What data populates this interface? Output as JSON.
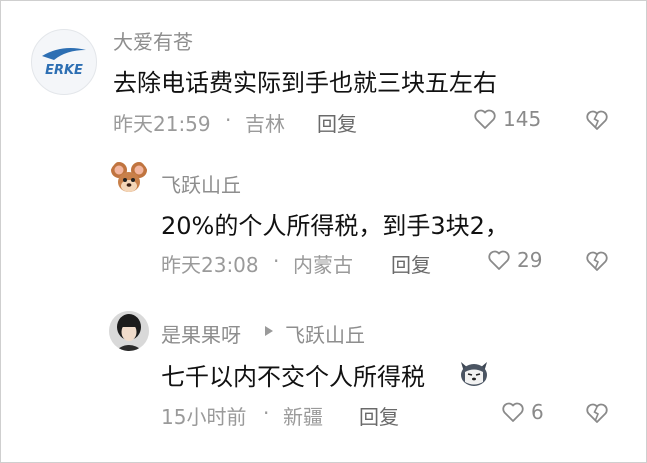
{
  "comments": [
    {
      "author": "大爱有苍",
      "avatar_text": "ERKE",
      "text": "去除电话费实际到手也就三块五左右",
      "time": "昨天21:59",
      "location": "吉林",
      "reply_label": "回复",
      "likes": "145"
    },
    {
      "author": "飞跃山丘",
      "text": "20%的个人所得税，到手3块2，",
      "time": "昨天23:08",
      "location": "内蒙古",
      "reply_label": "回复",
      "likes": "29"
    },
    {
      "author": "是果果呀",
      "reply_to": "飞跃山丘",
      "text": "七千以内不交个人所得税",
      "time": "15小时前",
      "location": "新疆",
      "reply_label": "回复",
      "likes": "6"
    }
  ],
  "separator": "·",
  "colors": {
    "text": "#111111",
    "muted": "#8e8e8e",
    "brand": "#2d6fb3"
  },
  "icons": [
    "heart-icon",
    "dislike-heart-icon",
    "reply-arrow-icon",
    "dog-emoji-icon"
  ]
}
